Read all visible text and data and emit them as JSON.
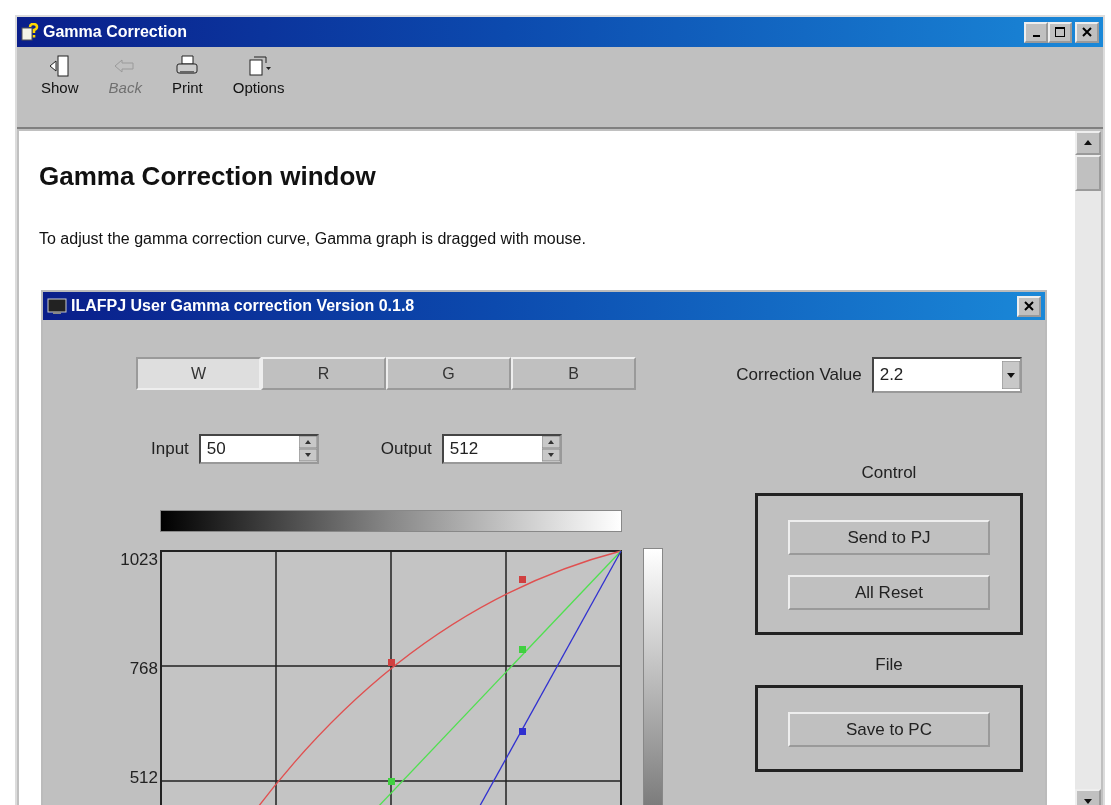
{
  "window": {
    "title": "Gamma Correction"
  },
  "toolbar": [
    {
      "label": "Show",
      "kind": "show",
      "disabled": false
    },
    {
      "label": "Back",
      "kind": "back",
      "disabled": true
    },
    {
      "label": "Print",
      "kind": "print",
      "disabled": false
    },
    {
      "label": "Options",
      "kind": "options",
      "disabled": false
    }
  ],
  "page": {
    "heading": "Gamma Correction window",
    "intro": "To adjust the gamma correction curve, Gamma graph is dragged with mouse."
  },
  "dialog": {
    "title": "ILAFPJ User Gamma correction Version 0.1.8",
    "tabs": [
      {
        "label": "W",
        "selected": true
      },
      {
        "label": "R",
        "selected": false
      },
      {
        "label": "G",
        "selected": false
      },
      {
        "label": "B",
        "selected": false
      }
    ],
    "correction_value": {
      "label": "Correction Value",
      "value": "2.2"
    },
    "input": {
      "label": "Input",
      "value": "50"
    },
    "output": {
      "label": "Output",
      "value": "512"
    },
    "y_axis_labels": [
      "1023",
      "768",
      "512"
    ],
    "groups": [
      {
        "title": "Control",
        "buttons": [
          "Send to PJ",
          "All Reset"
        ]
      },
      {
        "title": "File",
        "buttons": [
          "Save to PC"
        ]
      }
    ]
  }
}
